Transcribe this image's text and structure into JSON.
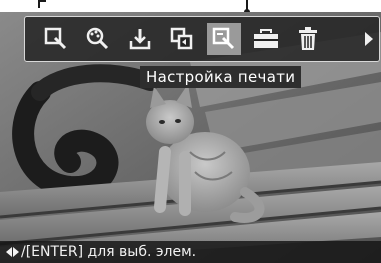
{
  "toolbar": {
    "buttons": [
      {
        "icon": "select-zoom-icon",
        "selected": false
      },
      {
        "icon": "color-zoom-icon",
        "selected": false
      },
      {
        "icon": "save-tray-icon",
        "selected": false
      },
      {
        "icon": "copy-rotate-icon",
        "selected": false
      },
      {
        "icon": "print-settings-icon",
        "selected": true
      },
      {
        "icon": "toolbox-icon",
        "selected": false
      },
      {
        "icon": "trash-icon",
        "selected": false
      }
    ],
    "more_icon": "arrow-right-icon"
  },
  "tooltip": {
    "text": "Настройка печати"
  },
  "hint": {
    "text": "/[ENTER] для выб. элем."
  },
  "colors": {
    "toolbar_bg": "#232323",
    "selected_bg": "#9a9a9a",
    "text": "#ffffff"
  }
}
